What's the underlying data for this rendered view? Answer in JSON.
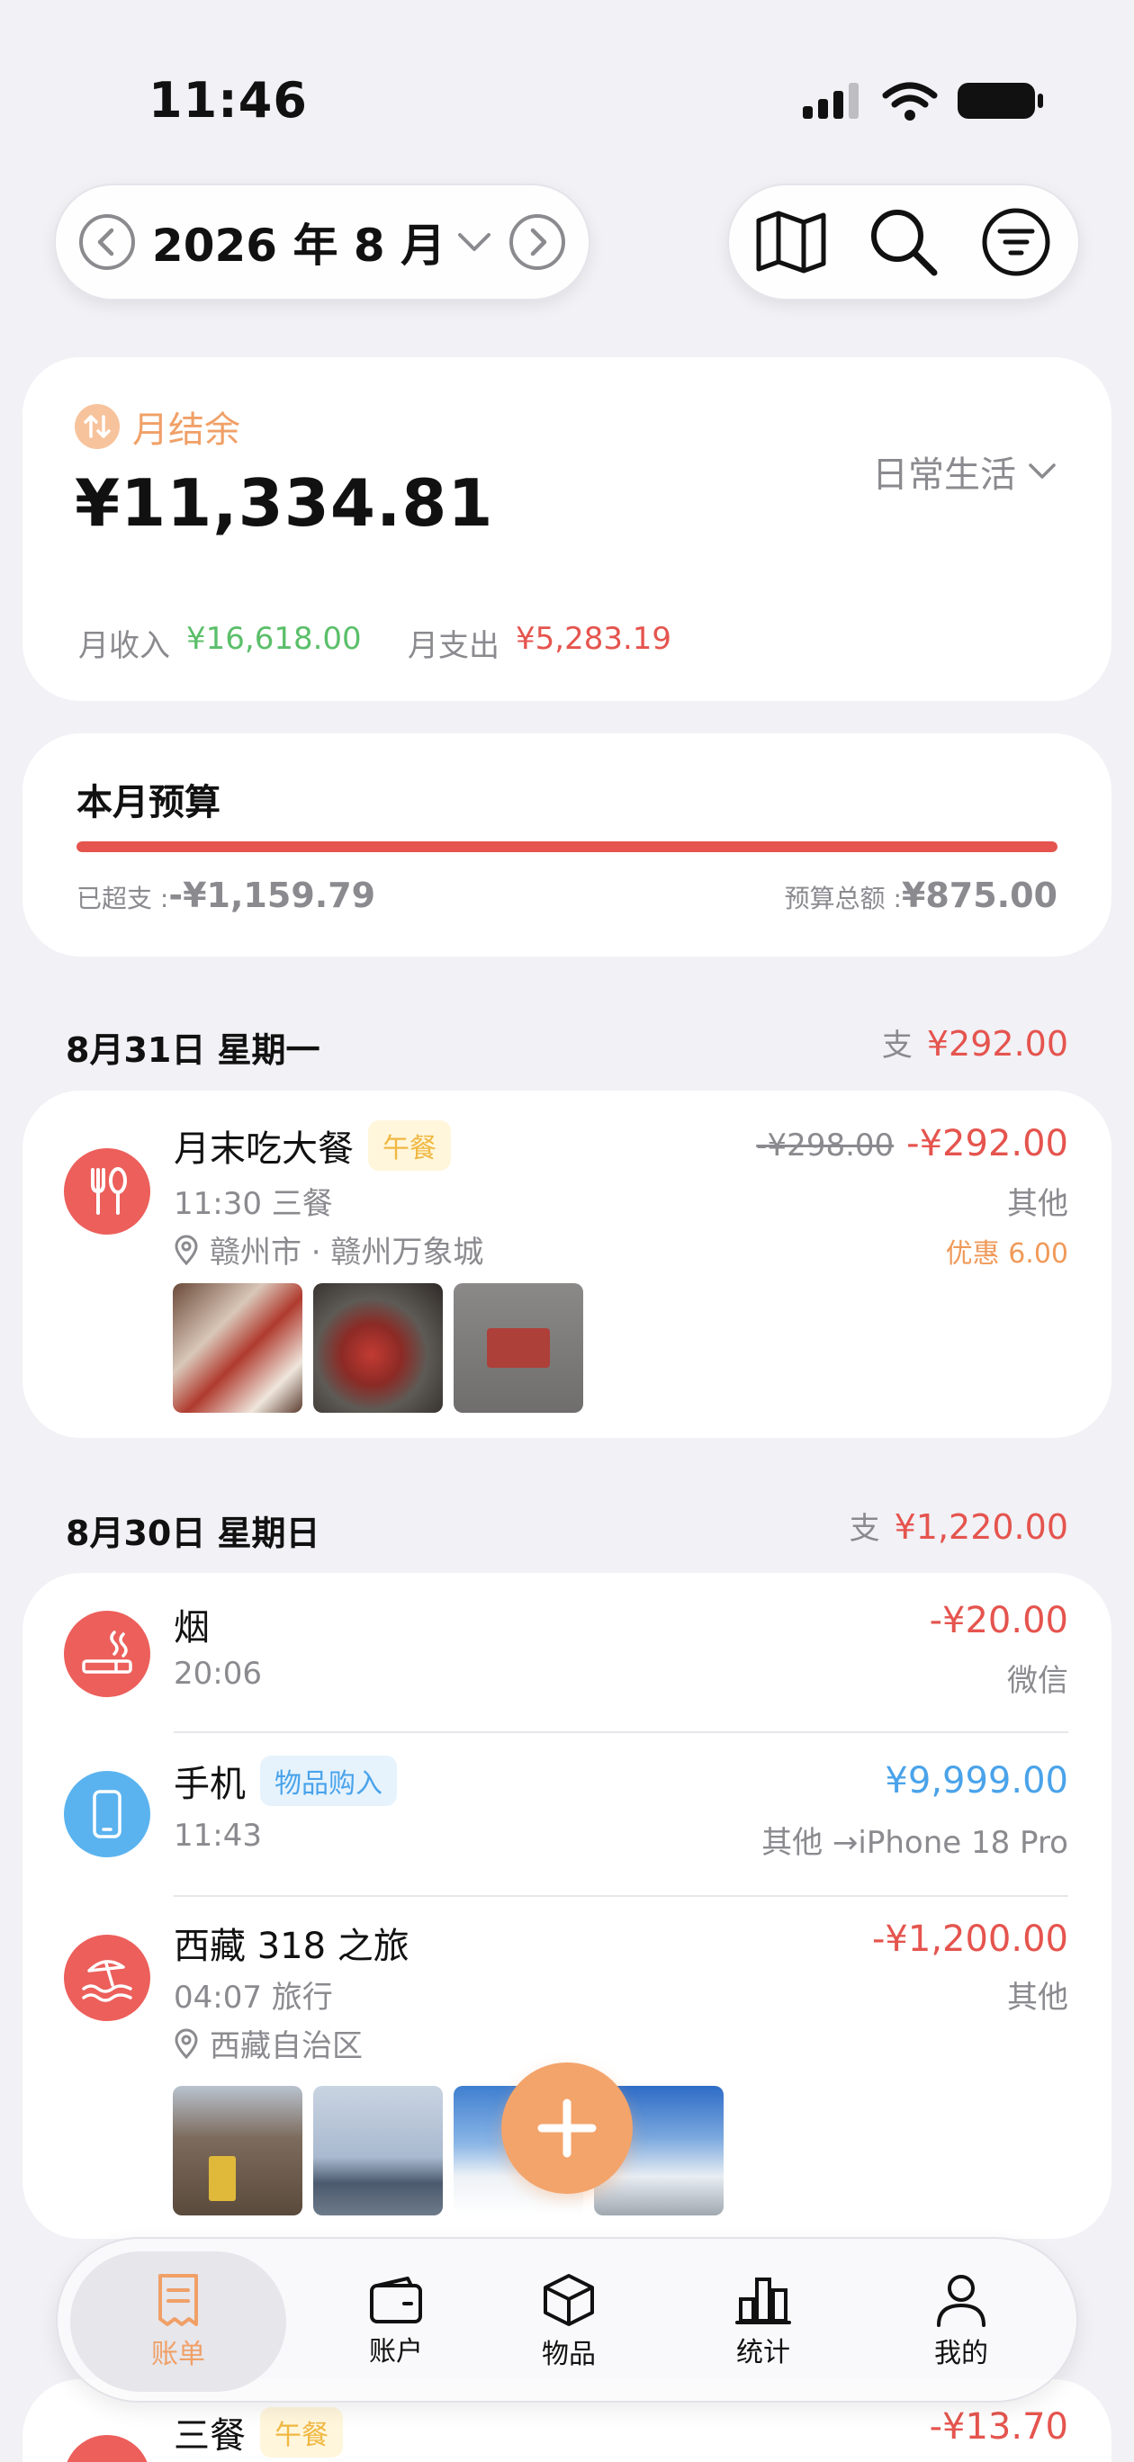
{
  "status": {
    "time": "11:46"
  },
  "header": {
    "month": "2026 年 8 月"
  },
  "summary": {
    "label": "月结余",
    "balance": "¥11,334.81",
    "ledger": "日常生活",
    "income_label": "月收入",
    "income": "¥16,618.00",
    "expense_label": "月支出",
    "expense": "¥5,283.19"
  },
  "budget": {
    "title": "本月预算",
    "over_label": "已超支 : ",
    "over_value": "-¥1,159.79",
    "total_label": "预算总额 : ",
    "total_value": "¥875.00",
    "progress_percent": 100
  },
  "days": [
    {
      "date": "8月31日 星期一",
      "total_prefix": "支",
      "total": "¥292.00",
      "entries": [
        {
          "title": "月末吃大餐",
          "tag": "午餐",
          "time_cat": "11:30  三餐",
          "location": "赣州市 · 赣州万象城",
          "original": "-¥298.00",
          "amount": "-¥292.00",
          "account": "其他",
          "discount": "优惠 6.00",
          "icon": "fork-spoon-icon"
        }
      ]
    },
    {
      "date": "8月30日 星期日",
      "total_prefix": "支",
      "total": "¥1,220.00",
      "entries": [
        {
          "title": "烟",
          "time_cat": "20:06",
          "amount": "-¥20.00",
          "account": "微信",
          "icon": "cigarette-icon"
        },
        {
          "title": "手机",
          "tag": "物品购入",
          "time_cat": "11:43",
          "amount": "¥9,999.00",
          "account": "其他 →iPhone 18 Pro",
          "icon": "phone-icon"
        },
        {
          "title": "西藏 318 之旅",
          "time_cat": "04:07  旅行",
          "location": "西藏自治区",
          "amount": "-¥1,200.00",
          "account": "其他",
          "icon": "beach-icon"
        }
      ]
    },
    {
      "entries": [
        {
          "title": "三餐",
          "tag": "午餐",
          "amount": "-¥13.70"
        }
      ]
    }
  ],
  "tabs": [
    {
      "label": "账单",
      "icon": "bill-icon",
      "active": true
    },
    {
      "label": "账户",
      "icon": "wallet-icon"
    },
    {
      "label": "物品",
      "icon": "box-icon"
    },
    {
      "label": "统计",
      "icon": "chart-icon"
    },
    {
      "label": "我的",
      "icon": "person-icon"
    }
  ],
  "colors": {
    "accent": "#f3a46b",
    "expense": "#e5544e",
    "income": "#5bbf6a",
    "transfer": "#4aa3ea",
    "background": "#f1f1f6"
  }
}
